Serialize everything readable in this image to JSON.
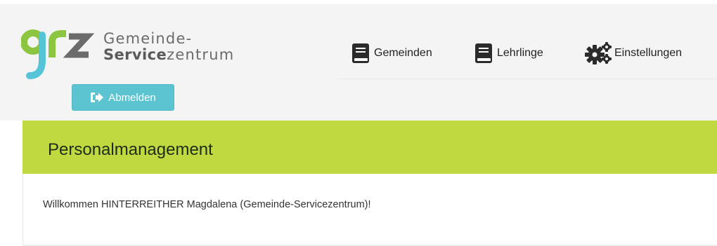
{
  "header": {
    "logo": {
      "mark": "gsz",
      "line1": "Gemeinde-",
      "line2_bold": "Service",
      "line2_rest": "zentrum",
      "colors": {
        "g": "#8cc540",
        "s": "#55c4d7",
        "z": "#6b6b6b"
      }
    },
    "nav": [
      {
        "label": "Gemeinden",
        "icon": "book-icon"
      },
      {
        "label": "Lehrlinge",
        "icon": "book-icon"
      },
      {
        "label": "Einstellungen",
        "icon": "gears-icon"
      }
    ],
    "logout": {
      "label": "Abmelden",
      "icon": "sign-out-icon"
    }
  },
  "banner": {
    "title": "Personalmanagement"
  },
  "content": {
    "welcome": "Willkommen HINTERREITHER Magdalena (Gemeinde-Servicezentrum)!"
  },
  "colors": {
    "banner": "#c1d941",
    "button": "#5cc4d1",
    "header_bg": "#f4f4f4"
  }
}
